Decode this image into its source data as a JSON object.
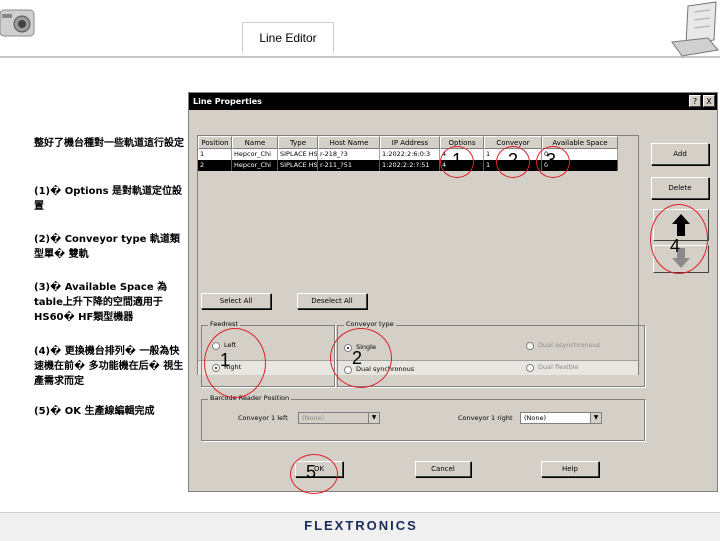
{
  "slide": {
    "title": "Line Editor",
    "footer_logo": "FLEXTRONICS"
  },
  "notes": [
    "整好了機台種對一些軌道這行設定",
    "(1)� Options 是對軌道定位設置",
    "(2)� Conveyor type 軌道類型單� 雙軌",
    "(3)� Available Space 為table上升下降的空間適用于HS60� HF類型機器",
    "(4)� 更換機台排列� 一般為快速機在前� 多功能機在后� 視生產需求而定",
    "(5)� OK 生產線編輯完成"
  ],
  "dialog": {
    "title": "Line Properties",
    "help_btn": "?",
    "close_btn": "X",
    "columns": [
      "Position",
      "Name",
      "Type",
      "Host Name",
      "IP Address",
      "Options",
      "Conveyor",
      "Available Space"
    ],
    "rows": [
      [
        "1",
        "Hepcor_Chi",
        "SIPLACE HS",
        "r-218_?3",
        "1:2022:2:6:0:3",
        "4",
        "1",
        "0"
      ],
      [
        "2",
        "Hepcor_Chi",
        "SIPLACE HS",
        "r-211_?51",
        "1:202:2:2:?:51",
        "4",
        "1",
        "0"
      ]
    ],
    "add_btn": "Add",
    "delete_btn": "Delete",
    "select_all_btn": "Select All",
    "deselect_all_btn": "Deselect All",
    "feedrest_group": "Feedrest",
    "feedrest_left": "Left",
    "feedrest_right": "Right",
    "conveyor_group": "Conveyor type",
    "conv_single": "Single",
    "conv_dual_sync": "Dual synchronous",
    "conv_dual_async": "Dual asynchronous",
    "conv_dual_flex": "Dual flexible",
    "barcode_group": "Barcode Reader Position",
    "conv1_left_label": "Conveyor 1 left",
    "conv1_left_value": "(None)",
    "conv1_right_label": "Conveyor 1 right",
    "conv1_right_value": "(None)",
    "ok_btn": "OK",
    "cancel_btn": "Cancel",
    "help_btn2": "Help"
  },
  "annotations": {
    "n1": "1",
    "n2": "2",
    "n3": "3",
    "n4": "4",
    "n5": "5",
    "n_feed": "1",
    "n_conv": "2"
  },
  "colors": {
    "annotation": "#e0202a",
    "titlebar": "#000000",
    "dialog_bg": "#d4d0c8"
  }
}
